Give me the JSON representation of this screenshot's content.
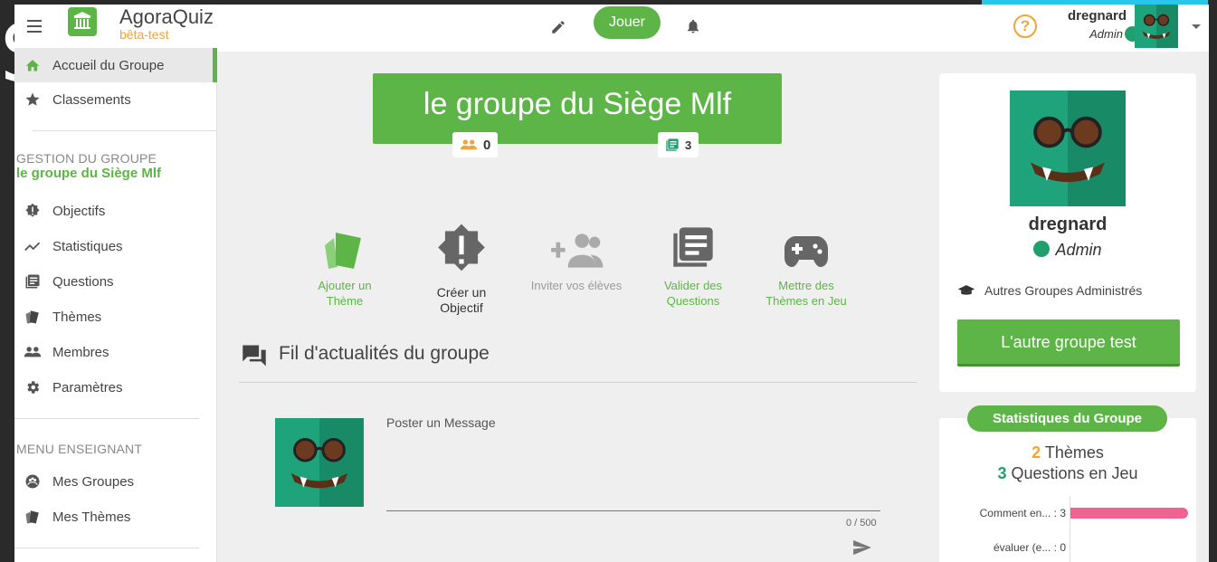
{
  "backdrop": {
    "letter": "S"
  },
  "topbar": {
    "app_name": "AgoraQuiz",
    "app_stage": "bêta-test",
    "play_label": "Jouer",
    "help_label": "?",
    "user_name": "dregnard",
    "user_role": "Admin"
  },
  "sidebar": {
    "items_top": [
      {
        "label": "Accueil du Groupe",
        "icon": "home-icon"
      },
      {
        "label": "Classements",
        "icon": "star-icon"
      }
    ],
    "management_heading": "GESTION DU GROUPE",
    "group_name": "le groupe du Siège Mlf",
    "items_management": [
      {
        "label": "Objectifs",
        "icon": "objective-badge-icon"
      },
      {
        "label": "Statistiques",
        "icon": "trend-icon"
      },
      {
        "label": "Questions",
        "icon": "questions-icon"
      },
      {
        "label": "Thèmes",
        "icon": "themes-cards-icon"
      },
      {
        "label": "Membres",
        "icon": "members-icon"
      },
      {
        "label": "Paramètres",
        "icon": "gear-icon"
      }
    ],
    "teacher_heading": "MENU ENSEIGNANT",
    "items_teacher": [
      {
        "label": "Mes Groupes",
        "icon": "groups-icon"
      },
      {
        "label": "Mes Thèmes",
        "icon": "themes-cards-icon"
      }
    ]
  },
  "main": {
    "group_title": "le groupe du Siège Mlf",
    "members_count": "0",
    "questions_count": "3",
    "actions": [
      {
        "label_line1": "Ajouter un",
        "label_line2": "Thème"
      },
      {
        "label_line1": "Créer un",
        "label_line2": "Objectif"
      },
      {
        "label_line1": "Inviter vos élèves",
        "label_line2": ""
      },
      {
        "label_line1": "Valider des",
        "label_line2": "Questions"
      },
      {
        "label_line1": "Mettre des",
        "label_line2": "Thèmes en Jeu"
      }
    ],
    "feed_title": "Fil d'actualités du groupe",
    "post_label": "Poster un Message",
    "post_counter": "0 / 500"
  },
  "profile": {
    "name": "dregnard",
    "role": "Admin",
    "other_groups_label": "Autres Groupes Administrés",
    "other_group_button": "L'autre groupe test"
  },
  "stats": {
    "title": "Statistiques du Groupe",
    "themes_count": "2",
    "themes_label": "Thèmes",
    "questions_count": "3",
    "questions_label": "Questions en Jeu",
    "bars": [
      {
        "label": "Comment en... : 3",
        "value": 3
      },
      {
        "label": "évaluer (e... : 0",
        "value": 0
      }
    ]
  },
  "colors": {
    "accent_green": "#5cb546",
    "orange": "#f2a33a",
    "teal": "#20a06f",
    "bar_pink": "#f06292"
  }
}
